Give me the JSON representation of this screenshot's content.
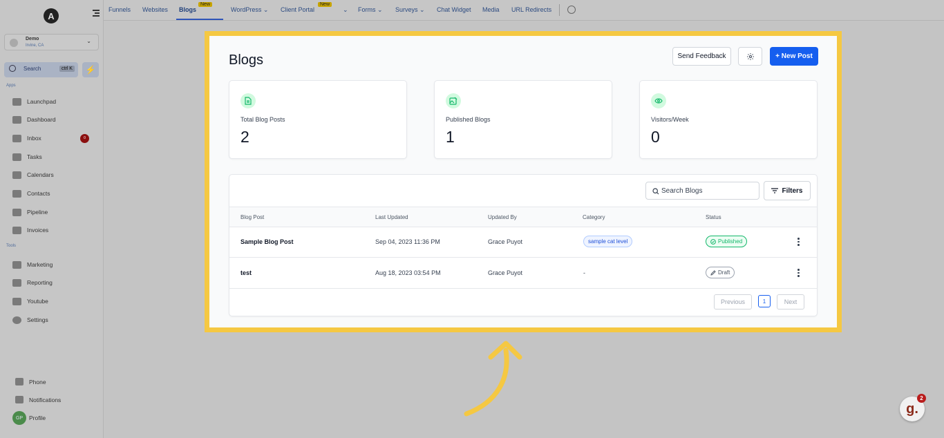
{
  "sidebar": {
    "logo_letter": "A",
    "account": {
      "name": "Demo",
      "location": "Irvine, CA"
    },
    "search": {
      "label": "Search",
      "shortcut": "ctrl K"
    },
    "section_apps": "Apps",
    "section_tools": "Tools",
    "apps": [
      {
        "label": "Launchpad"
      },
      {
        "label": "Dashboard"
      },
      {
        "label": "Inbox",
        "badge": "0"
      },
      {
        "label": "Tasks"
      },
      {
        "label": "Calendars"
      },
      {
        "label": "Contacts"
      },
      {
        "label": "Pipeline"
      },
      {
        "label": "Invoices"
      }
    ],
    "tools": [
      {
        "label": "Marketing"
      },
      {
        "label": "Reporting"
      },
      {
        "label": "Youtube"
      },
      {
        "label": "Settings"
      }
    ],
    "bottom": {
      "phone": "Phone",
      "notifications": "Notifications",
      "profile": "Profile",
      "profile_initials": "GP"
    }
  },
  "topnav": {
    "tabs": [
      "Funnels",
      "Websites",
      "Blogs",
      "WordPress",
      "Client Portal",
      "Forms",
      "Surveys",
      "Chat Widget",
      "Media",
      "URL Redirects"
    ],
    "new_tag": "New",
    "active_tab": "Blogs"
  },
  "main": {
    "title": "Blogs",
    "send_feedback": "Send Feedback",
    "new_post": "+ New Post",
    "stats": [
      {
        "label": "Total Blog Posts",
        "value": "2",
        "icon": "document-icon"
      },
      {
        "label": "Published Blogs",
        "value": "1",
        "icon": "image-edit-icon"
      },
      {
        "label": "Visitors/Week",
        "value": "0",
        "icon": "eye-icon"
      }
    ],
    "search_placeholder": "Search Blogs",
    "filters": "Filters",
    "columns": [
      "Blog Post",
      "Last Updated",
      "Updated By",
      "Category",
      "Status"
    ],
    "rows": [
      {
        "title": "Sample Blog Post",
        "updated": "Sep 04, 2023 11:36 PM",
        "by": "Grace Puyot",
        "category": "sample cat level",
        "status": "Published"
      },
      {
        "title": "test",
        "updated": "Aug 18, 2023 03:54 PM",
        "by": "Grace Puyot",
        "category": "-",
        "status": "Draft"
      }
    ],
    "pagination": {
      "previous": "Previous",
      "page": "1",
      "next": "Next"
    }
  },
  "widget": {
    "letter": "g.",
    "badge": "2"
  },
  "colors": {
    "accent": "#155eef",
    "highlight": "#f5c842",
    "published": "#12b76a"
  }
}
